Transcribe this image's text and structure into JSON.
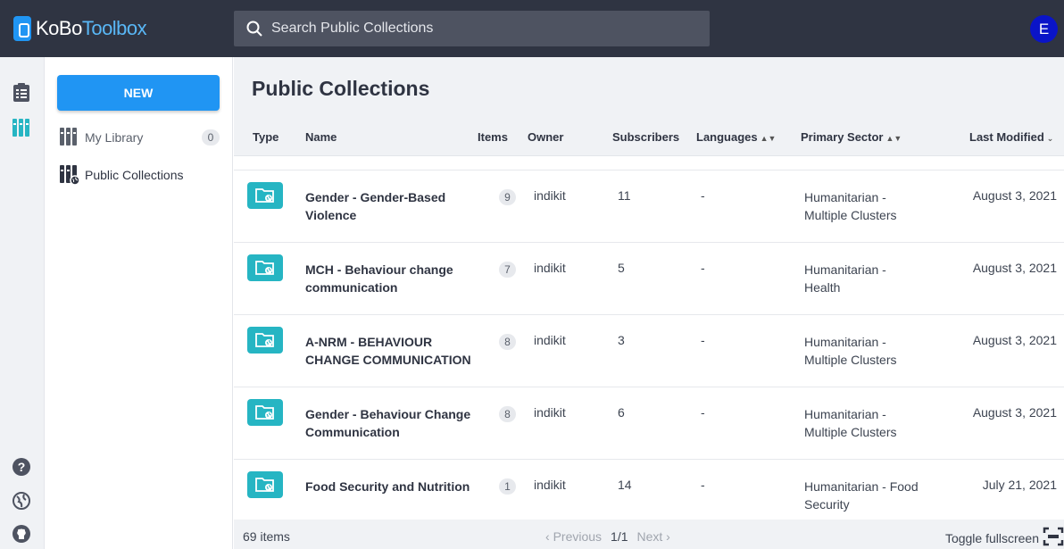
{
  "app": {
    "logo_bold": "KoBo",
    "logo_light": "Toolbox",
    "user_initial": "E"
  },
  "search": {
    "placeholder": "Search Public Collections"
  },
  "sidebar": {
    "new_label": "NEW",
    "items": [
      {
        "label": "My Library",
        "badge": "0"
      },
      {
        "label": "Public Collections"
      }
    ]
  },
  "main": {
    "title": "Public Collections",
    "columns": {
      "type": "Type",
      "name": "Name",
      "items": "Items",
      "owner": "Owner",
      "subscribers": "Subscribers",
      "languages": "Languages",
      "sector": "Primary Sector",
      "modified": "Last Modified"
    },
    "rows": [
      {
        "name": "Gender - Gender-Based Violence",
        "items": "9",
        "owner": "indikit",
        "subscribers": "11",
        "languages": "-",
        "sector": "Humanitarian - Multiple Clusters",
        "modified": "August 3, 2021"
      },
      {
        "name": "MCH - Behaviour change communication",
        "items": "7",
        "owner": "indikit",
        "subscribers": "5",
        "languages": "-",
        "sector": "Humanitarian - Health",
        "modified": "August 3, 2021"
      },
      {
        "name": "A-NRM - BEHAVIOUR CHANGE COMMUNICATION",
        "items": "8",
        "owner": "indikit",
        "subscribers": "3",
        "languages": "-",
        "sector": "Humanitarian - Multiple Clusters",
        "modified": "August 3, 2021"
      },
      {
        "name": "Gender - Behaviour Change Communication",
        "items": "8",
        "owner": "indikit",
        "subscribers": "6",
        "languages": "-",
        "sector": "Humanitarian - Multiple Clusters",
        "modified": "August 3, 2021"
      },
      {
        "name": "Food Security and Nutrition",
        "items": "1",
        "owner": "indikit",
        "subscribers": "14",
        "languages": "-",
        "sector": "Humanitarian - Food Security",
        "modified": "July 21, 2021"
      }
    ],
    "footer": {
      "count": "69 items",
      "prev": "Previous",
      "page": "1/1",
      "next": "Next",
      "fullscreen": "Toggle fullscreen"
    }
  },
  "colors": {
    "topbar": "#2f3442",
    "accent": "#2095f3",
    "type_icon": "#26b5c3"
  }
}
